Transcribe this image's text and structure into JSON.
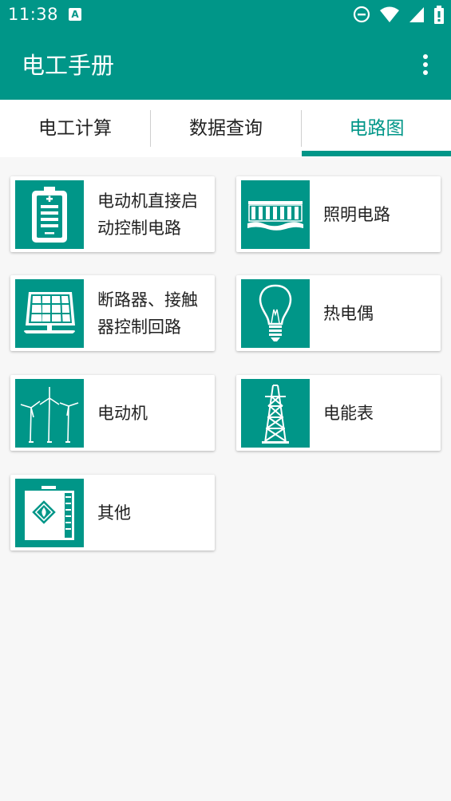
{
  "status_bar": {
    "time": "11:38",
    "notification_glyph": "A",
    "icons": [
      "do-not-disturb-icon",
      "wifi-icon",
      "cell-signal-icon",
      "battery-icon"
    ]
  },
  "app_bar": {
    "title": "电工手册",
    "overflow_icon": "more-vert-icon"
  },
  "tabs": [
    {
      "label": "电工计算",
      "active": false
    },
    {
      "label": "数据查询",
      "active": false
    },
    {
      "label": "电路图",
      "active": true
    }
  ],
  "accent_color": "#009688",
  "cards": [
    {
      "label": "电动机直接启动控制电路",
      "icon": "battery-icon"
    },
    {
      "label": "照明电路",
      "icon": "power-plant-icon"
    },
    {
      "label": "断路器、接触器控制回路",
      "icon": "solar-panel-icon"
    },
    {
      "label": "热电偶",
      "icon": "light-bulb-icon"
    },
    {
      "label": "电动机",
      "icon": "wind-turbine-icon"
    },
    {
      "label": "电能表",
      "icon": "power-tower-icon"
    },
    {
      "label": "其他",
      "icon": "fuel-tank-icon"
    }
  ]
}
